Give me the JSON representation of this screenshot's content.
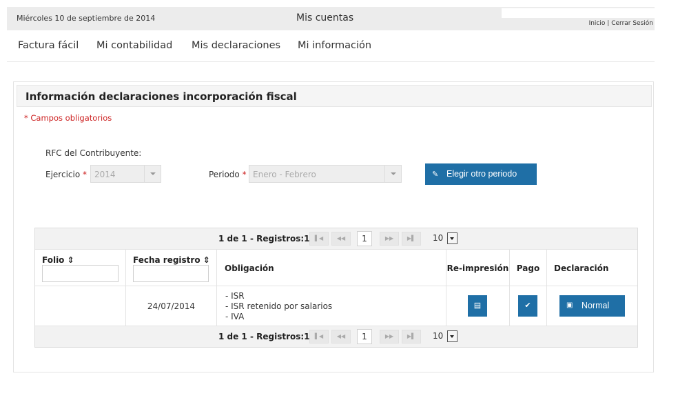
{
  "topbar": {
    "date": "Miércoles 10 de septiembre de 2014",
    "title": "Mis cuentas",
    "link_home": "Inicio",
    "separator": "|",
    "link_logout": "Cerrar Sesión"
  },
  "nav": {
    "items": [
      "Factura fácil",
      "Mi contabilidad",
      "Mis declaraciones",
      "Mi información"
    ]
  },
  "panel": {
    "title": "Información declaraciones incorporación fiscal",
    "required_note": "* Campos obligatorios"
  },
  "form": {
    "rfc_label": "RFC del Contribuyente:",
    "ejercicio_label": "Ejercicio",
    "ejercicio_value": "2014",
    "periodo_label": "Periodo",
    "periodo_value": "Enero - Febrero",
    "required_mark": "*",
    "change_period_button": "Elegir otro periodo"
  },
  "pager": {
    "info": "1 de 1 - Registros:1",
    "page": "1",
    "page_size": "10",
    "first": "▌◀",
    "prev": "◀◀",
    "next": "▶▶",
    "last": "▶▌"
  },
  "table": {
    "headers": {
      "folio": "Folio",
      "fecha": "Fecha registro",
      "obligacion": "Obligación",
      "reimpresion": "Re-impresión",
      "pago": "Pago",
      "declaracion": "Declaración"
    },
    "rows": [
      {
        "folio": "",
        "fecha": "24/07/2014",
        "obligaciones": [
          "- ISR",
          "- ISR retenido por salarios",
          "- IVA"
        ],
        "declaracion_button": "Normal"
      }
    ]
  },
  "icons": {
    "edit": "pencil-icon",
    "print": "print-icon",
    "pay": "check-icon",
    "declaration": "document-icon",
    "sort": "sort-icon"
  },
  "colors": {
    "primary": "#1f6fa6",
    "required": "#cc1f1f",
    "topbar_bg": "#ececec"
  }
}
